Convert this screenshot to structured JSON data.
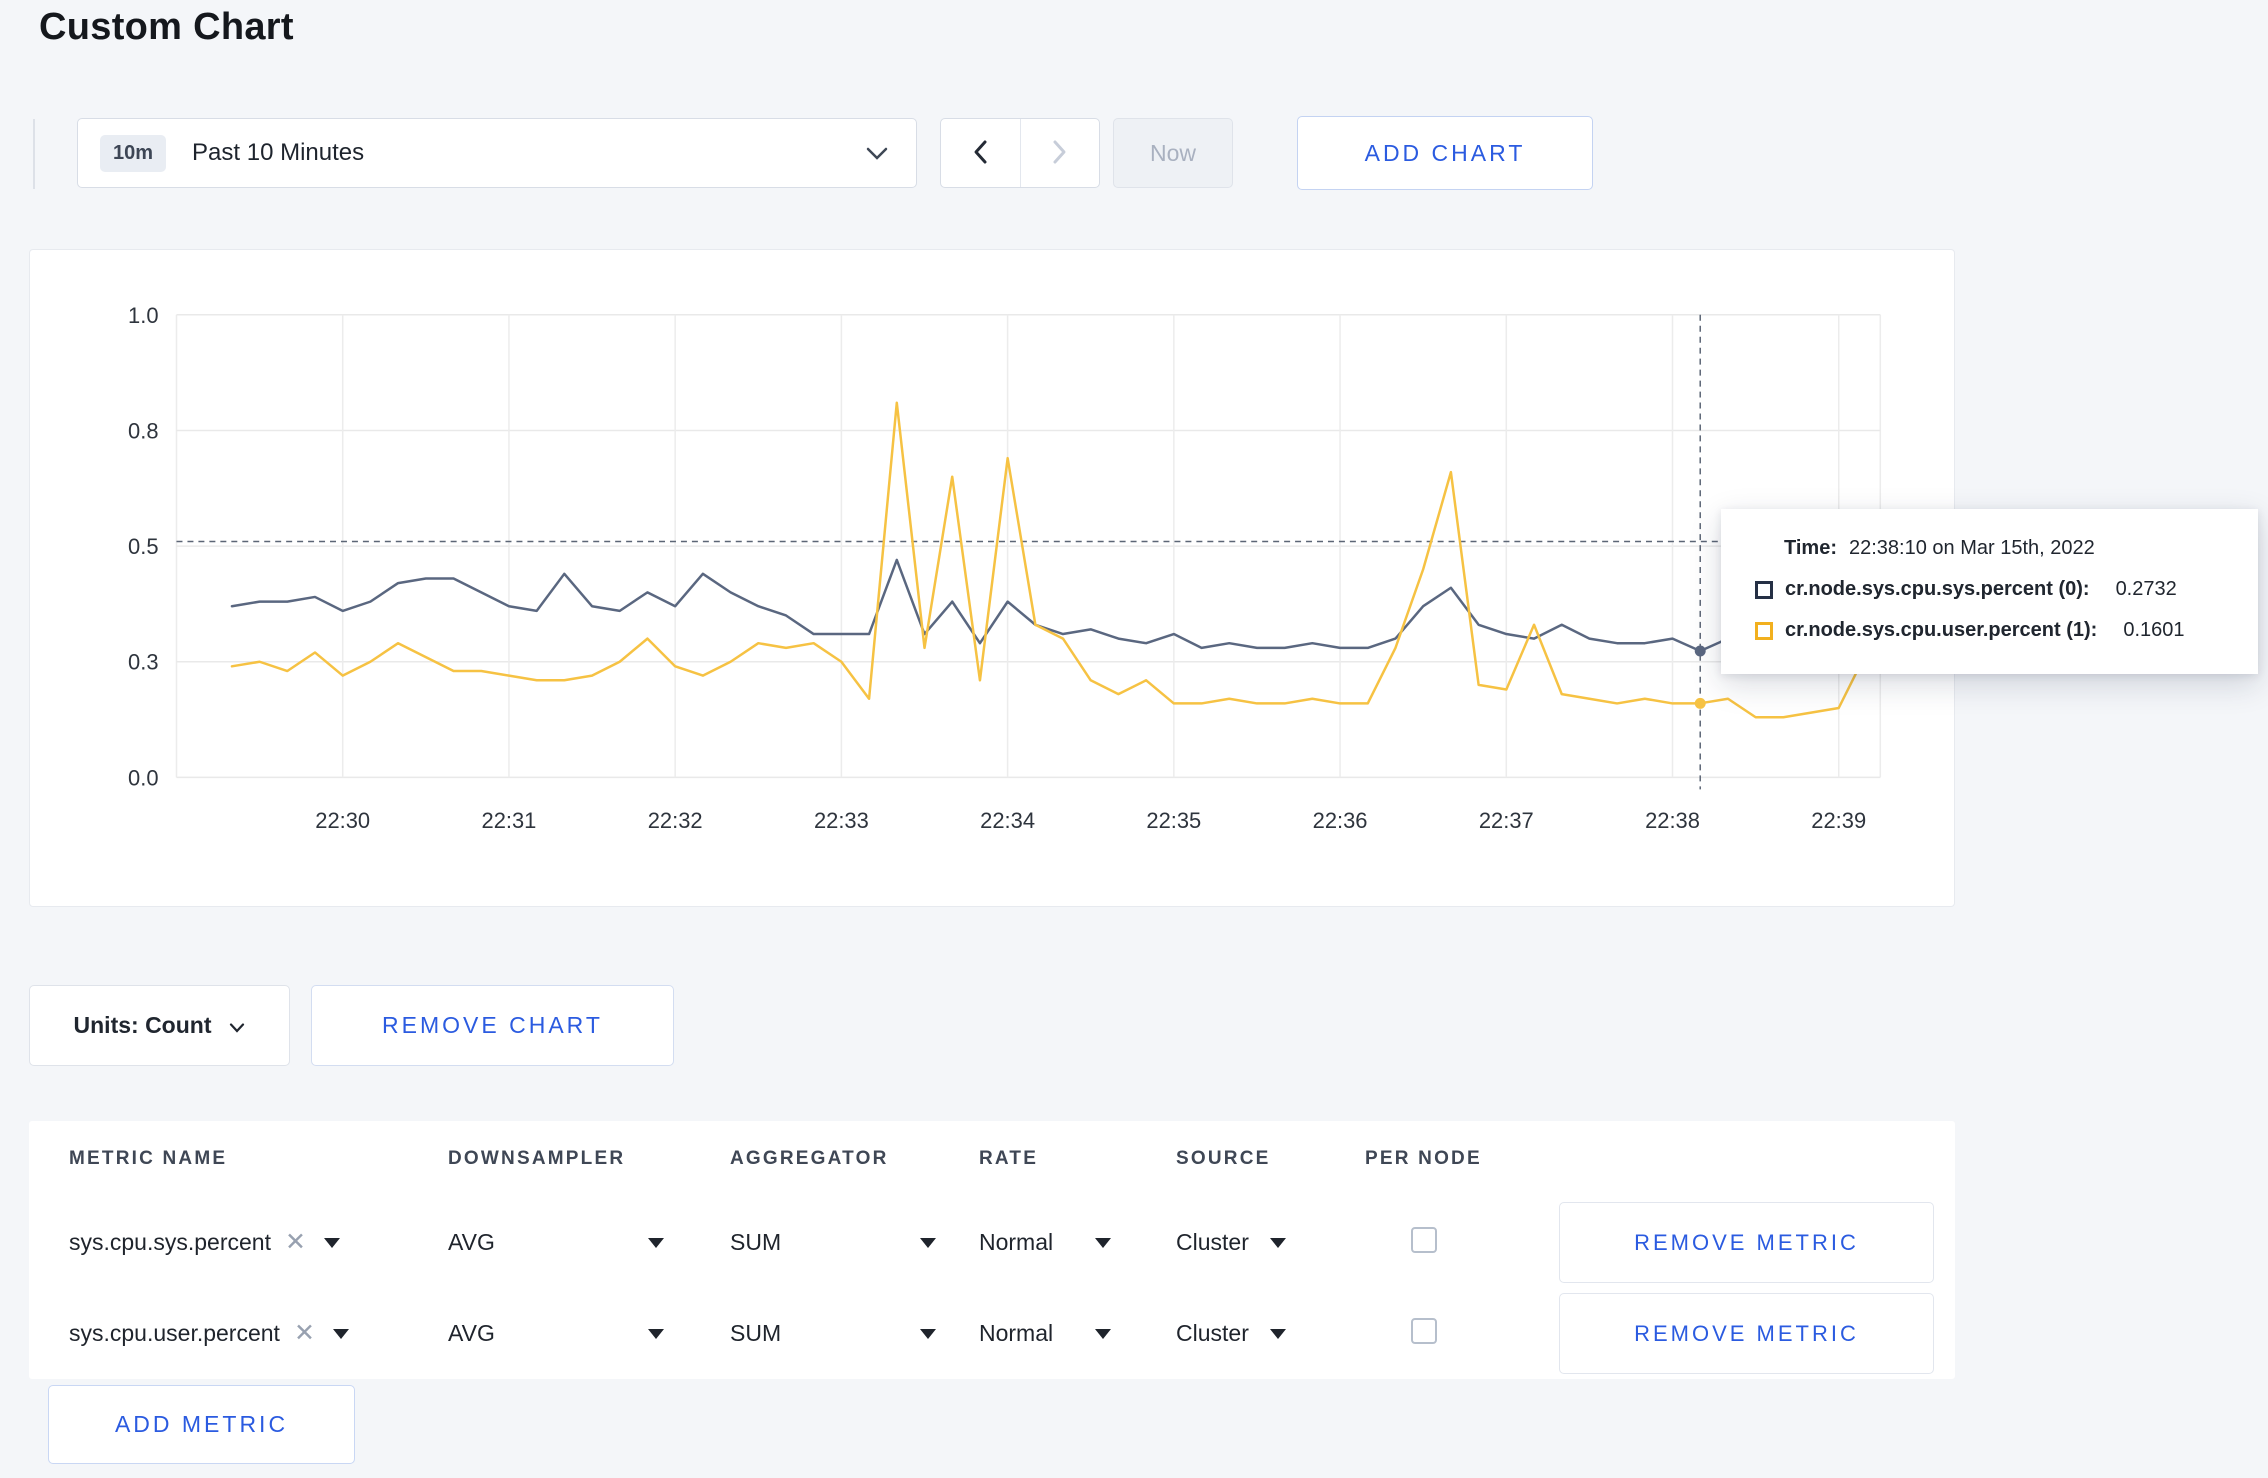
{
  "page": {
    "title": "Custom Chart"
  },
  "colors": {
    "accent_blue": "#2b5be0",
    "series_sys_line": "#5a6780",
    "series_user_line": "#f6c243",
    "page_background": "#f4f6f9"
  },
  "toolbar": {
    "time_badge": "10m",
    "time_label": "Past 10 Minutes",
    "now_label": "Now",
    "add_chart_label": "ADD CHART"
  },
  "chart_data": {
    "type": "line",
    "title": "",
    "x_domain": [
      29.0,
      39.25
    ],
    "x_unit": "minutes after 22:00 on Mar 15th, 2022",
    "x_ticks": [
      30,
      31,
      32,
      33,
      34,
      35,
      36,
      37,
      38,
      39
    ],
    "x_tick_labels": [
      "22:30",
      "22:31",
      "22:32",
      "22:33",
      "22:34",
      "22:35",
      "22:36",
      "22:37",
      "22:38",
      "22:39"
    ],
    "y_domain": [
      0,
      1.0
    ],
    "y_gridlines": [
      0,
      0.25,
      0.5,
      0.75,
      1.0
    ],
    "y_tick_labels": [
      "0.0",
      "0.3",
      "0.5",
      "0.8",
      "1.0"
    ],
    "x_start": 29.3333,
    "x_step": 0.16667,
    "grid": true,
    "series": [
      {
        "name": "cr.node.sys.cpu.sys.percent",
        "color": "#5a6780",
        "values": [
          0.37,
          0.38,
          0.38,
          0.39,
          0.36,
          0.38,
          0.42,
          0.43,
          0.43,
          0.4,
          0.37,
          0.36,
          0.44,
          0.37,
          0.36,
          0.4,
          0.37,
          0.44,
          0.4,
          0.37,
          0.35,
          0.31,
          0.31,
          0.31,
          0.47,
          0.31,
          0.38,
          0.29,
          0.38,
          0.33,
          0.31,
          0.32,
          0.3,
          0.29,
          0.31,
          0.28,
          0.29,
          0.28,
          0.28,
          0.29,
          0.28,
          0.28,
          0.3,
          0.37,
          0.41,
          0.33,
          0.31,
          0.3,
          0.33,
          0.3,
          0.29,
          0.29,
          0.3,
          0.2732,
          0.3,
          0.32,
          0.3,
          0.3,
          0.31,
          0.3
        ]
      },
      {
        "name": "cr.node.sys.cpu.user.percent",
        "color": "#f6c243",
        "values": [
          0.24,
          0.25,
          0.23,
          0.27,
          0.22,
          0.25,
          0.29,
          0.26,
          0.23,
          0.23,
          0.22,
          0.21,
          0.21,
          0.22,
          0.25,
          0.3,
          0.24,
          0.22,
          0.25,
          0.29,
          0.28,
          0.29,
          0.25,
          0.17,
          0.81,
          0.28,
          0.65,
          0.21,
          0.69,
          0.33,
          0.3,
          0.21,
          0.18,
          0.21,
          0.16,
          0.16,
          0.17,
          0.16,
          0.16,
          0.17,
          0.16,
          0.16,
          0.28,
          0.45,
          0.66,
          0.2,
          0.19,
          0.33,
          0.18,
          0.17,
          0.16,
          0.17,
          0.16,
          0.1601,
          0.17,
          0.13,
          0.13,
          0.14,
          0.15,
          0.27
        ]
      }
    ],
    "crosshair": {
      "x": 38.1667,
      "y": 0.51
    },
    "hover_points": [
      {
        "series": 0,
        "value": 0.2732
      },
      {
        "series": 1,
        "value": 0.1601
      }
    ]
  },
  "tooltip": {
    "time_label": "Time:",
    "time_value": "22:38:10 on Mar 15th, 2022",
    "series": [
      {
        "label": "cr.node.sys.cpu.sys.percent (0):",
        "value": "0.2732",
        "color": "#253045"
      },
      {
        "label": "cr.node.sys.cpu.user.percent (1):",
        "value": "0.1601",
        "color": "#f2b01e"
      }
    ]
  },
  "chart_controls": {
    "units_label": "Units: Count",
    "remove_chart_label": "REMOVE CHART"
  },
  "metrics_table": {
    "headers": [
      "METRIC NAME",
      "DOWNSAMPLER",
      "AGGREGATOR",
      "RATE",
      "SOURCE",
      "PER NODE"
    ],
    "close_glyph": "✕",
    "rows": [
      {
        "metric": "sys.cpu.sys.percent",
        "downsampler": "AVG",
        "aggregator": "SUM",
        "rate": "Normal",
        "source": "Cluster",
        "per_node_checked": false,
        "remove_label": "REMOVE METRIC"
      },
      {
        "metric": "sys.cpu.user.percent",
        "downsampler": "AVG",
        "aggregator": "SUM",
        "rate": "Normal",
        "source": "Cluster",
        "per_node_checked": false,
        "remove_label": "REMOVE METRIC"
      }
    ],
    "add_metric_label": "ADD METRIC"
  }
}
